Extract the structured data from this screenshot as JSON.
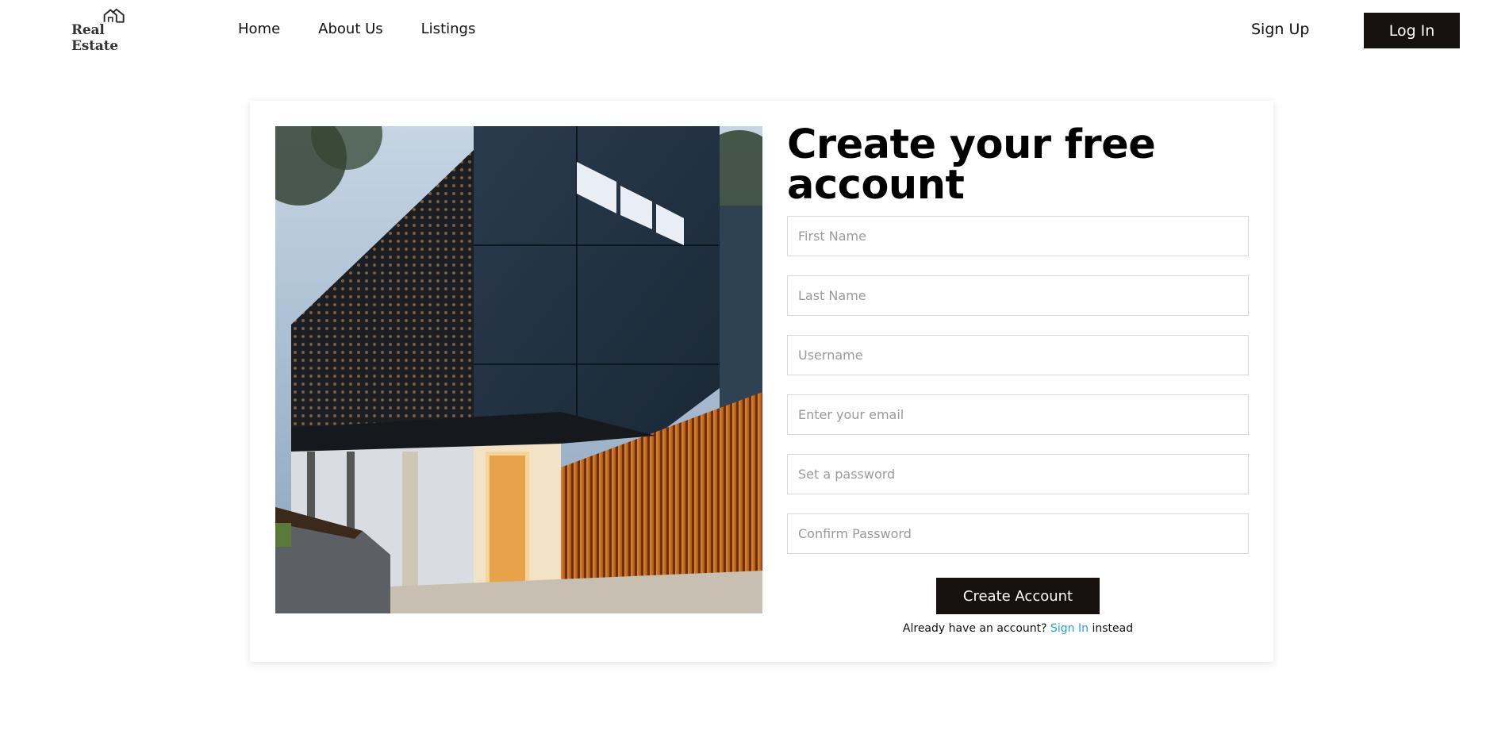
{
  "header": {
    "logo_text": "Real Estate",
    "logo_icon": "house-icon",
    "nav": [
      {
        "label": "Home"
      },
      {
        "label": "About Us"
      },
      {
        "label": "Listings"
      }
    ],
    "signup_label": "Sign Up",
    "login_label": "Log In"
  },
  "main": {
    "image": "modern-house-photo",
    "title": "Create your free account",
    "fields": [
      {
        "placeholder": "First Name"
      },
      {
        "placeholder": "Last Name"
      },
      {
        "placeholder": "Username"
      },
      {
        "placeholder": "Enter your email"
      },
      {
        "placeholder": "Set a password"
      },
      {
        "placeholder": "Confirm Password"
      }
    ],
    "submit_label": "Create Account",
    "footer": {
      "prefix": "Already have an account?",
      "link": "Sign In",
      "suffix": "instead"
    }
  },
  "colors": {
    "dark_button": "#16110e",
    "link": "#2a9fd8"
  }
}
